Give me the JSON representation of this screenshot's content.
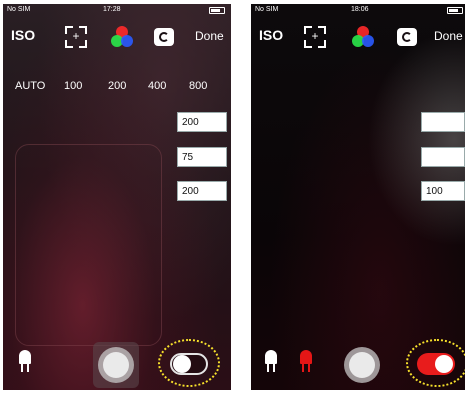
{
  "left": {
    "status": {
      "carrier": "No SIM",
      "time": "17:28"
    },
    "toolbar": {
      "iso_label": "ISO",
      "done_label": "Done"
    },
    "iso_values": [
      "AUTO",
      "100",
      "200",
      "400",
      "800"
    ],
    "fields": [
      "200",
      "75",
      "200"
    ],
    "flash_toggle": {
      "state": "off"
    }
  },
  "right": {
    "status": {
      "carrier": "No SIM",
      "time": "18:06"
    },
    "toolbar": {
      "iso_label": "ISO",
      "done_label": "Done"
    },
    "fields": [
      "",
      "",
      "100"
    ],
    "flash_toggle": {
      "state": "on"
    }
  },
  "colors": {
    "accent_red": "#e81c1c",
    "highlight_ring": "#f7e12b"
  }
}
